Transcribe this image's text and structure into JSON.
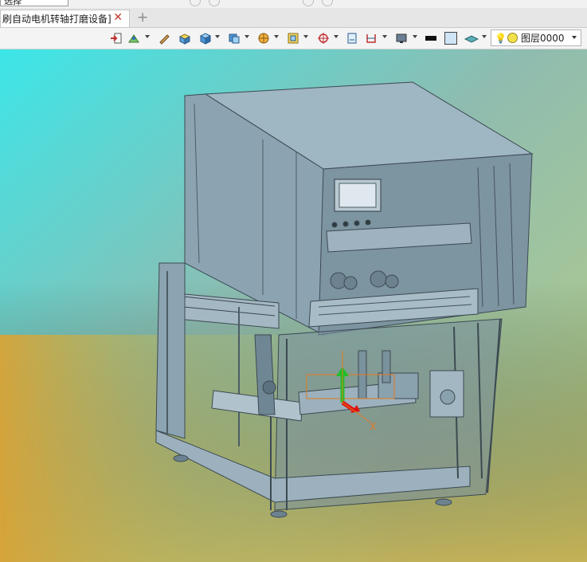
{
  "top_strip": {
    "selection_label": "选择"
  },
  "tabs": [
    {
      "label": "刷自动电机转轴打磨设备]",
      "close_symbol": "✕"
    }
  ],
  "tab_add_symbol": "+",
  "toolbar": {
    "icons": [
      "import-icon",
      "sketch-icon",
      "pen-icon",
      "box-face-icon",
      "cube-icon",
      "view-orient-icon",
      "render-mode-icon",
      "section-icon",
      "snap-target-icon",
      "sheet-icon",
      "measure-icon",
      "display-icon",
      "color-black-icon",
      "color-swatch-icon",
      "material-icon"
    ],
    "color_black": "#111111",
    "color_swatch": "#cfe4f4"
  },
  "layer": {
    "label": "图层0000",
    "bulb_color": "#d9b200",
    "dot_color": "#f2e14a"
  },
  "viewport": {
    "gradient": {
      "top_left": "#3ce6e8",
      "top_right": "#b5c7c2",
      "bottom_left": "#d2a339",
      "bottom_right": "#a9d27e"
    },
    "model_color": "#8fa9b7",
    "axis_labels": {
      "x": "X"
    }
  }
}
